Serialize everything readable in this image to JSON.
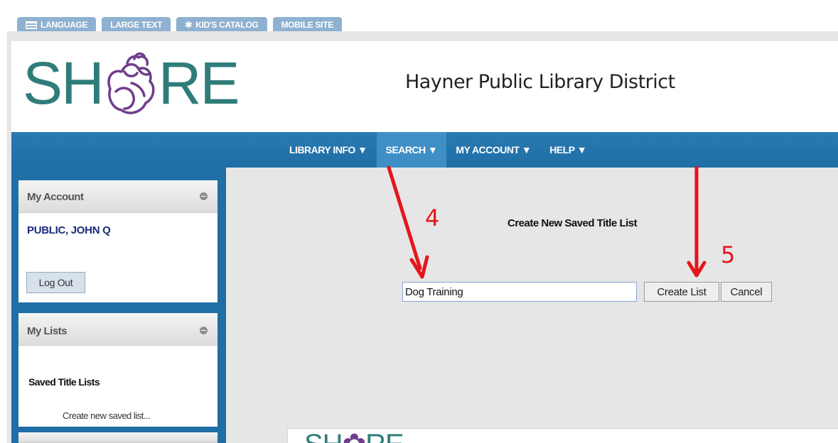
{
  "top_tabs": [
    {
      "label": "LANGUAGE",
      "icon": "flag-icon"
    },
    {
      "label": "LARGE TEXT",
      "icon": ""
    },
    {
      "label": "KID'S CATALOG",
      "icon": "star-icon"
    },
    {
      "label": "MOBILE SITE",
      "icon": ""
    }
  ],
  "logo": {
    "left": "SH",
    "right": "RE"
  },
  "library_name": "Hayner Public Library District",
  "nav": [
    {
      "label": "LIBRARY INFO ▼"
    },
    {
      "label": "SEARCH ▼"
    },
    {
      "label": "MY ACCOUNT ▼"
    },
    {
      "label": "HELP ▼"
    }
  ],
  "account_panel": {
    "title": "My Account",
    "user": "PUBLIC, JOHN Q",
    "logout_label": "Log Out"
  },
  "lists_panel": {
    "title": "My Lists",
    "saved_label": "Saved Title Lists",
    "create_link": "Create new saved list..."
  },
  "form": {
    "title": "Create New Saved Title List",
    "input_value": "Dog Training",
    "create_label": "Create List",
    "cancel_label": "Cancel"
  },
  "annotations": {
    "step4": "4",
    "step5": "5"
  },
  "colors": {
    "brand_teal": "#2f7d7a",
    "brand_purple": "#6f3d8c",
    "nav_blue": "#1f6ea6",
    "annotation_red": "#e5161b"
  }
}
